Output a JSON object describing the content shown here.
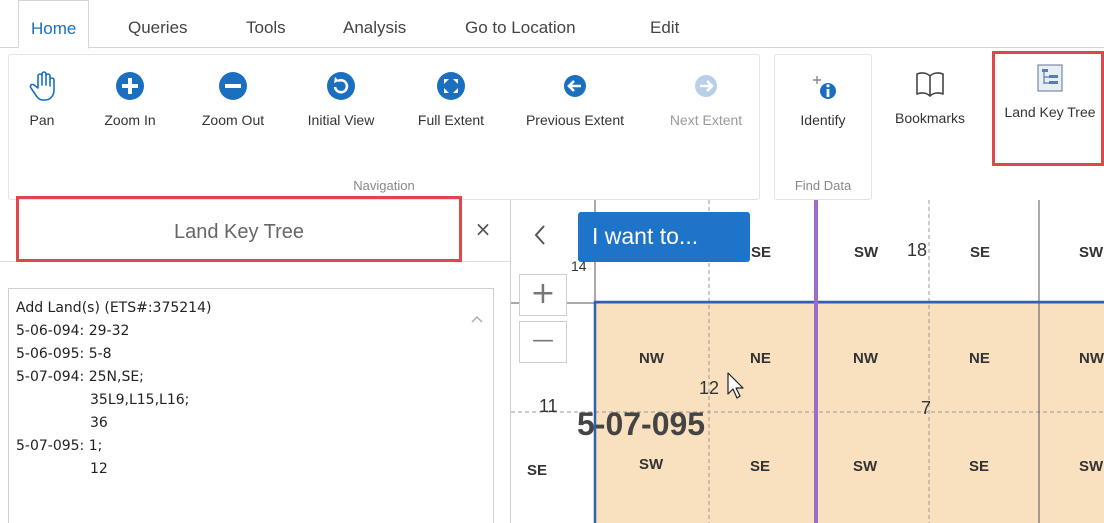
{
  "tabs": [
    {
      "label": "Home"
    },
    {
      "label": "Queries"
    },
    {
      "label": "Tools"
    },
    {
      "label": "Analysis"
    },
    {
      "label": "Go to Location"
    },
    {
      "label": "Edit"
    }
  ],
  "ribbon": {
    "navigation": {
      "label": "Navigation",
      "buttons": [
        {
          "label": "Pan",
          "icon": "hand-icon"
        },
        {
          "label": "Zoom In",
          "icon": "plus-circle-icon"
        },
        {
          "label": "Zoom Out",
          "icon": "minus-circle-icon"
        },
        {
          "label": "Initial View",
          "icon": "refresh-icon"
        },
        {
          "label": "Full Extent",
          "icon": "expand-icon"
        },
        {
          "label": "Previous Extent",
          "icon": "arrow-left-icon"
        },
        {
          "label": "Next Extent",
          "icon": "arrow-right-icon"
        }
      ]
    },
    "find_data": {
      "label": "Find Data",
      "buttons": [
        {
          "label": "Identify",
          "icon": "identify-icon"
        }
      ]
    },
    "extra": {
      "buttons": [
        {
          "label": "Bookmarks",
          "icon": "book-icon"
        },
        {
          "label": "Land Key Tree",
          "icon": "tree-icon"
        }
      ]
    }
  },
  "panel": {
    "title": "Land Key Tree",
    "close": "×",
    "tree_lines": [
      "Add Land(s) (ETS#:375214)",
      "5-06-094: 29-32",
      "5-06-095: 5-8",
      "5-07-094: 25N,SE;",
      "35L9,L15,L16;",
      "36",
      "5-07-095: 1;",
      "12"
    ]
  },
  "map": {
    "i_want_to": "I want to...",
    "zoom_in": "+",
    "zoom_out": "—",
    "collapse": "<",
    "township_label": "5-07-095",
    "section_numbers": {
      "s14": "14",
      "s18": "18",
      "s12": "12",
      "s11": "11",
      "s7": "7"
    },
    "quarters": {
      "top_se1": "SE",
      "top_sw": "SW",
      "top_se2": "SE",
      "top_sw2": "SW",
      "nw1": "NW",
      "ne1": "NE",
      "nw2": "NW",
      "ne2": "NE",
      "nw3": "NW",
      "se0": "SE",
      "sw1": "SW",
      "se1": "SE",
      "sw2": "SW",
      "se2": "SE",
      "sw3": "SW"
    },
    "colors": {
      "selected_fill": "#f9e0bf",
      "township_line": "#2f5fb6",
      "boundary_purple": "#9b6dc4",
      "accent": "#1d74c9",
      "highlight": "#e0474c"
    }
  }
}
